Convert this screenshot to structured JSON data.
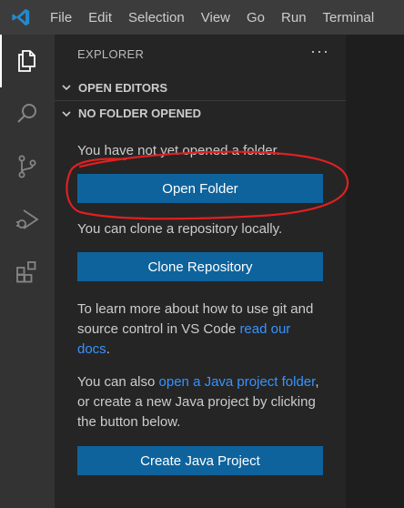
{
  "menu": {
    "items": [
      "File",
      "Edit",
      "Selection",
      "View",
      "Go",
      "Run",
      "Terminal"
    ]
  },
  "activity_icons": [
    "explorer-icon",
    "search-icon",
    "source-control-icon",
    "run-debug-icon",
    "extensions-icon"
  ],
  "explorer": {
    "title": "EXPLORER",
    "more": "···",
    "open_editors": "OPEN EDITORS",
    "no_folder": "NO FOLDER OPENED",
    "text1": "You have not yet opened a folder.",
    "open_folder_label": "Open Folder",
    "text2": "You can clone a repository locally.",
    "clone_label": "Clone Repository",
    "text3": "To learn more about how to use git and source control in VS Code ",
    "text3_link": "read our docs",
    "text3_end": ".",
    "text4_start": "You can also ",
    "text4_link": "open a Java project folder",
    "text4_end": ", or create a new Java project by clicking the button below.",
    "java_label": "Create Java Project"
  },
  "colors": {
    "accent_button": "#0e639c",
    "link": "#3794ff",
    "annotation": "#e02020"
  }
}
